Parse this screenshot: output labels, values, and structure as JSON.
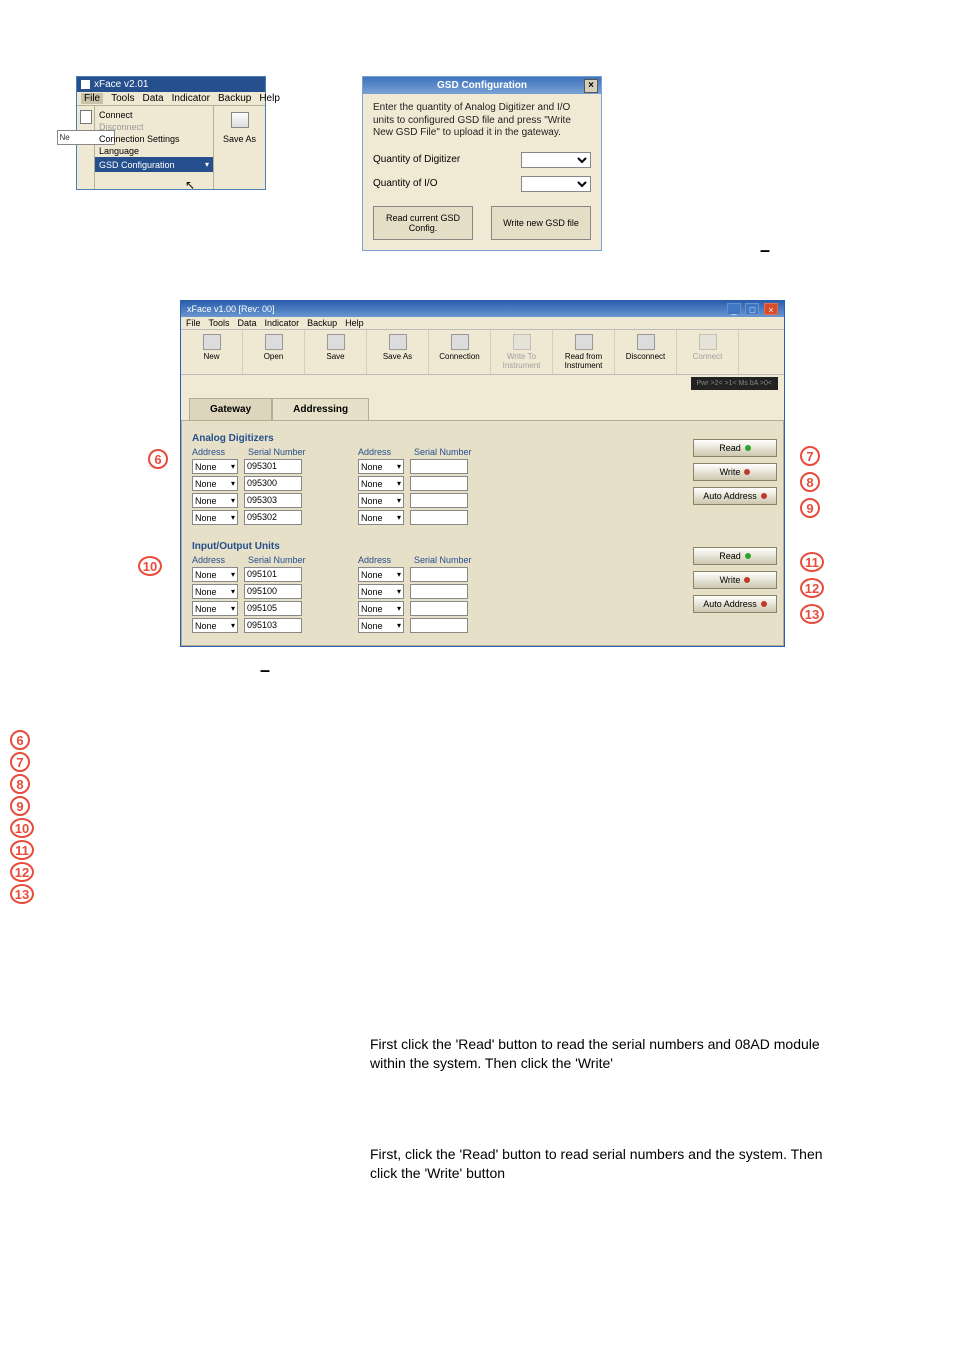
{
  "ss1": {
    "title": "xFace  v2.01",
    "menu": [
      "File",
      "Tools",
      "Data",
      "Indicator",
      "Backup",
      "Help"
    ],
    "col1_label": "Ne",
    "items": {
      "connect": "Connect",
      "disconnect": "Disconnect",
      "conn_settings": "Connection Settings",
      "language": "Language",
      "gsd": "GSD Configuration"
    },
    "save_as": "Save As"
  },
  "ss2": {
    "title": "GSD Configuration",
    "close": "×",
    "desc": "Enter the quantity of Analog Digitizer and I/O units to configured GSD file and press \"Write New GSD File\" to upload it in the gateway.",
    "q_dig": "Quantity of Digitizer",
    "q_io": "Quantity of I/O",
    "btn_read": "Read current GSD Config.",
    "btn_write": "Write new GSD file"
  },
  "ss3": {
    "title": "xFace  v1.00      [Rev: 00]",
    "menu": [
      "File",
      "Tools",
      "Data",
      "Indicator",
      "Backup",
      "Help"
    ],
    "toolbar": {
      "new": "New",
      "open": "Open",
      "save": "Save",
      "saveas": "Save As",
      "connection": "Connection",
      "writeto": "Write To Instrument",
      "readfrom": "Read from Instrument",
      "disconnect": "Disconnect",
      "connect": "Connect"
    },
    "leds": "Pwr   >2<   >1<   Ms   bA   >0<",
    "tabs": {
      "gateway": "Gateway",
      "addressing": "Addressing"
    },
    "analog": {
      "title": "Analog Digitizers",
      "hdr_addr": "Address",
      "hdr_sn": "Serial Number",
      "rows": [
        {
          "addr": "None",
          "sn": "095301"
        },
        {
          "addr": "None",
          "sn": "095300"
        },
        {
          "addr": "None",
          "sn": "095303"
        },
        {
          "addr": "None",
          "sn": "095302"
        }
      ],
      "right_rows": [
        "None",
        "None",
        "None",
        "None"
      ]
    },
    "io": {
      "title": "Input/Output Units",
      "rows": [
        {
          "addr": "None",
          "sn": "095101"
        },
        {
          "addr": "None",
          "sn": "095100"
        },
        {
          "addr": "None",
          "sn": "095105"
        },
        {
          "addr": "None",
          "sn": "095103"
        }
      ],
      "right_rows": [
        "None",
        "None",
        "None",
        "None"
      ]
    },
    "btns": {
      "read": "Read",
      "write": "Write",
      "auto": "Auto Address"
    }
  },
  "callouts": {
    "c6": "6",
    "c7": "7",
    "c8": "8",
    "c9": "9",
    "c10": "10",
    "c11": "11",
    "c12": "12",
    "c13": "13"
  },
  "dash": "–",
  "para1": "First click the 'Read' button to read the serial numbers and 08AD module within the system. Then click the 'Write'",
  "para2": "First, click the 'Read' button to read serial numbers and the system. Then click the 'Write' button"
}
